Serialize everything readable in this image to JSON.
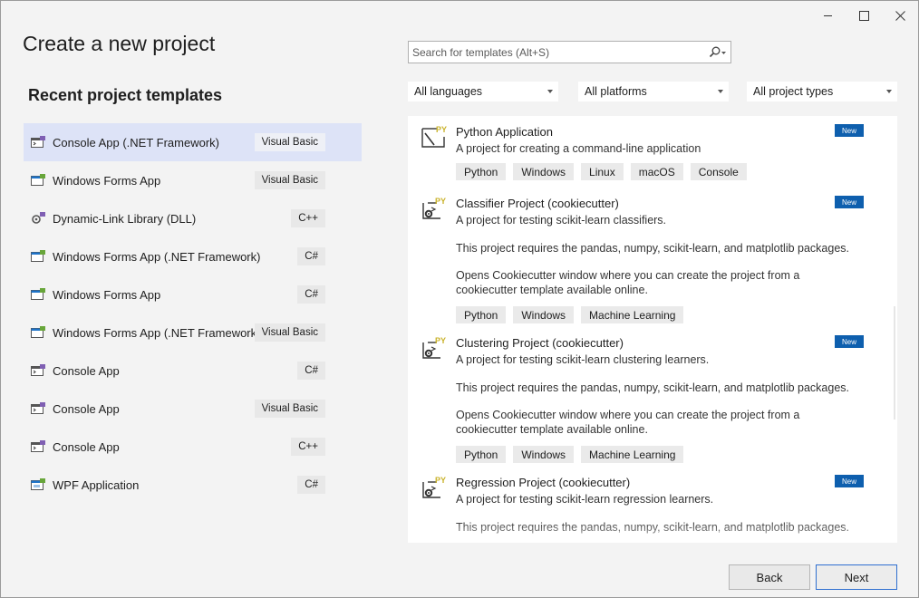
{
  "window": {
    "controls": [
      {
        "name": "minimize-icon"
      },
      {
        "name": "maximize-icon"
      },
      {
        "name": "close-icon"
      }
    ]
  },
  "title": "Create a new project",
  "recent": {
    "heading": "Recent project templates",
    "items": [
      {
        "label": "Console App (.NET Framework)",
        "lang": "Visual Basic",
        "icon": "console-app-icon",
        "selected": true
      },
      {
        "label": "Windows Forms App",
        "lang": "Visual Basic",
        "icon": "windows-forms-icon"
      },
      {
        "label": "Dynamic-Link Library (DLL)",
        "lang": "C++",
        "icon": "dll-icon"
      },
      {
        "label": "Windows Forms App (.NET Framework)",
        "lang": "C#",
        "icon": "windows-forms-icon"
      },
      {
        "label": "Windows Forms App",
        "lang": "C#",
        "icon": "windows-forms-icon"
      },
      {
        "label": "Windows Forms App (.NET Framework)",
        "lang": "Visual Basic",
        "icon": "windows-forms-icon"
      },
      {
        "label": "Console App",
        "lang": "C#",
        "icon": "console-app-icon"
      },
      {
        "label": "Console App",
        "lang": "Visual Basic",
        "icon": "console-app-icon"
      },
      {
        "label": "Console App",
        "lang": "C++",
        "icon": "console-app-icon"
      },
      {
        "label": "WPF Application",
        "lang": "C#",
        "icon": "wpf-app-icon"
      }
    ]
  },
  "search": {
    "placeholder": "Search for templates (Alt+S)",
    "value": ""
  },
  "filters": {
    "language": "All languages",
    "platform": "All platforms",
    "project_type": "All project types"
  },
  "templates": [
    {
      "name": "Python Application",
      "description": "A project for creating a command-line application",
      "badge": "New",
      "icon": "python-application-icon",
      "paragraphs": [],
      "tags": [
        "Python",
        "Windows",
        "Linux",
        "macOS",
        "Console"
      ]
    },
    {
      "name": "Classifier Project (cookiecutter)",
      "description": "A project for testing scikit-learn classifiers.",
      "badge": "New",
      "icon": "python-cookiecutter-icon",
      "paragraphs": [
        "This project requires the pandas, numpy, scikit-learn, and matplotlib packages.",
        "Opens Cookiecutter window where you can create the project from a cookiecutter template available online."
      ],
      "tags": [
        "Python",
        "Windows",
        "Machine Learning"
      ]
    },
    {
      "name": "Clustering Project (cookiecutter)",
      "description": "A project for testing scikit-learn clustering learners.",
      "badge": "New",
      "icon": "python-cookiecutter-icon",
      "paragraphs": [
        "This project requires the pandas, numpy, scikit-learn, and matplotlib packages.",
        "Opens Cookiecutter window where you can create the project from a cookiecutter template available online."
      ],
      "tags": [
        "Python",
        "Windows",
        "Machine Learning"
      ]
    },
    {
      "name": "Regression Project (cookiecutter)",
      "description": "A project for testing scikit-learn regression learners.",
      "badge": "New",
      "icon": "python-cookiecutter-icon",
      "paragraphs": [
        "This project requires the pandas, numpy, scikit-learn, and matplotlib packages."
      ],
      "tags": []
    }
  ],
  "buttons": {
    "back": "Back",
    "next": "Next"
  },
  "colors": {
    "selected_row": "#dde3f7",
    "new_badge": "#0e5fae",
    "next_border": "#2f6fd0",
    "python_yellow": "#c9b22a"
  }
}
